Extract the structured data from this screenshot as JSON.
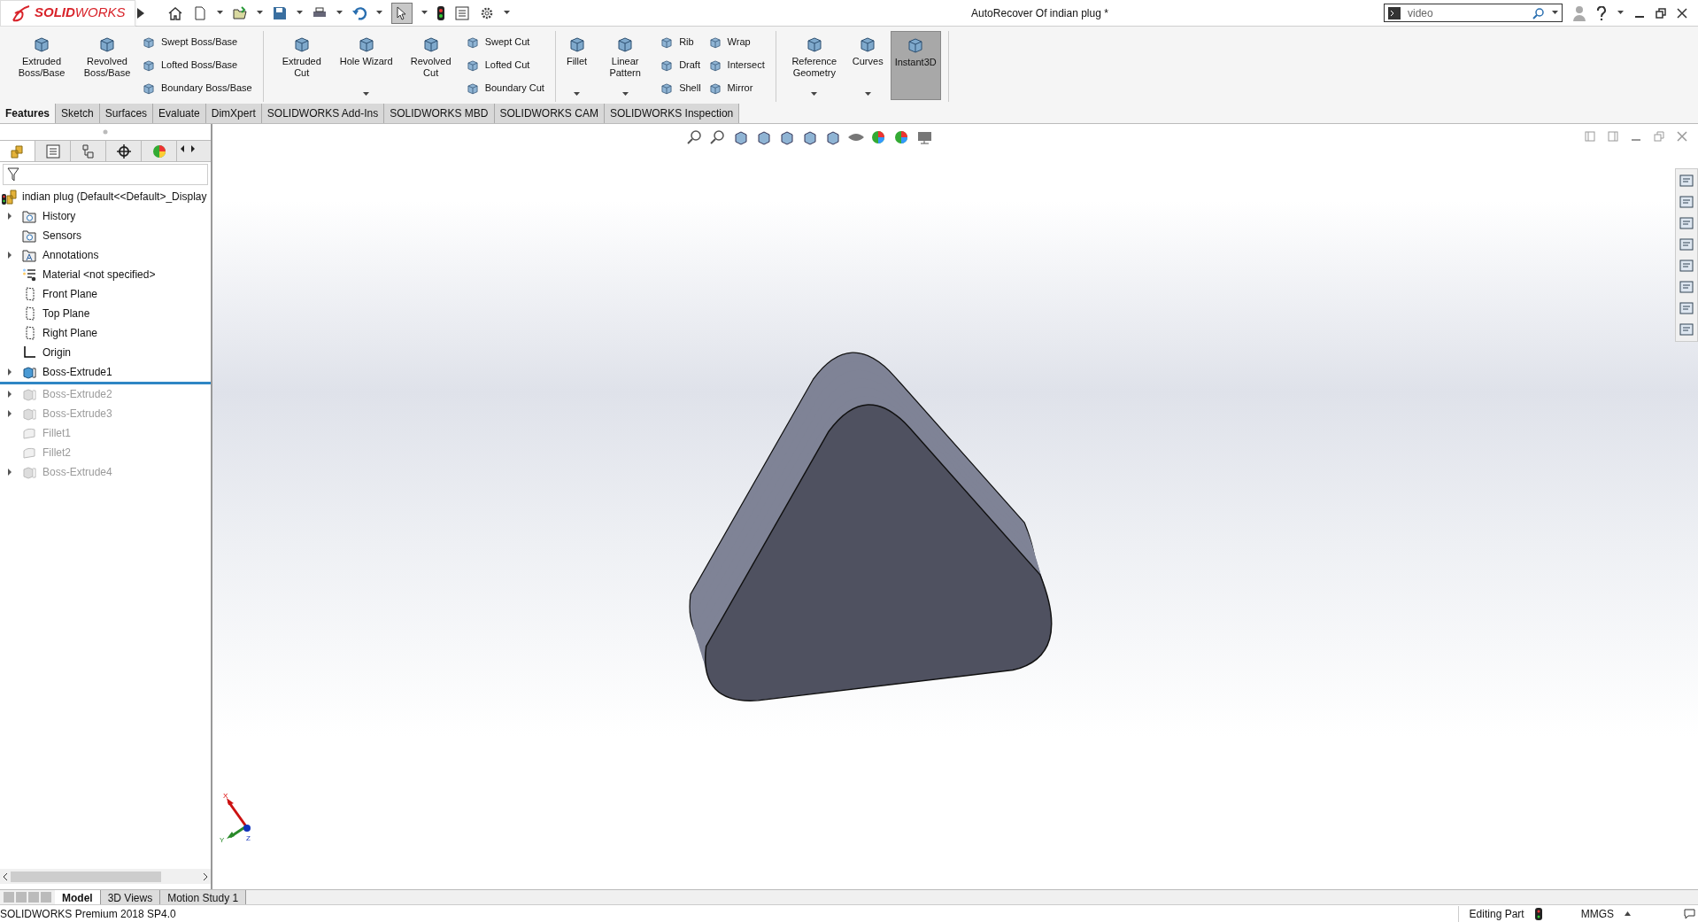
{
  "title_bar": {
    "logo": {
      "prefix": "SOLID",
      "suffix": "WORKS"
    },
    "select_tool": {
      "selected": true
    },
    "document_title": "AutoRecover Of indian plug *",
    "search": {
      "value": "video"
    }
  },
  "command_groups": [
    [
      {
        "kind": "large",
        "label": "Extruded Boss/Base",
        "dropdown": false,
        "selected": false
      },
      {
        "kind": "large",
        "label": "Revolved Boss/Base",
        "dropdown": false,
        "selected": false
      },
      {
        "kind": "stack",
        "items": [
          {
            "label": "Swept Boss/Base"
          },
          {
            "label": "Lofted Boss/Base"
          },
          {
            "label": "Boundary Boss/Base"
          }
        ]
      }
    ],
    [
      {
        "kind": "large",
        "label": "Extruded Cut",
        "dropdown": false,
        "selected": false
      },
      {
        "kind": "large",
        "label": "Hole Wizard",
        "dropdown": true,
        "selected": false
      },
      {
        "kind": "large",
        "label": "Revolved Cut",
        "dropdown": false,
        "selected": false
      },
      {
        "kind": "stack",
        "items": [
          {
            "label": "Swept Cut"
          },
          {
            "label": "Lofted Cut"
          },
          {
            "label": "Boundary Cut"
          }
        ]
      }
    ],
    [
      {
        "kind": "large",
        "label": "Fillet",
        "dropdown": true,
        "selected": false
      },
      {
        "kind": "large",
        "label": "Linear Pattern",
        "dropdown": true,
        "selected": false
      },
      {
        "kind": "stack",
        "items": [
          {
            "label": "Rib"
          },
          {
            "label": "Draft"
          },
          {
            "label": "Shell"
          }
        ]
      },
      {
        "kind": "stack",
        "items": [
          {
            "label": "Wrap"
          },
          {
            "label": "Intersect"
          },
          {
            "label": "Mirror"
          }
        ]
      }
    ],
    [
      {
        "kind": "large",
        "label": "Reference Geometry",
        "dropdown": true,
        "selected": false
      },
      {
        "kind": "large",
        "label": "Curves",
        "dropdown": true,
        "selected": false
      },
      {
        "kind": "large",
        "label": "Instant3D",
        "dropdown": false,
        "selected": true
      }
    ]
  ],
  "tabs": [
    {
      "label": "Features",
      "selected": true
    },
    {
      "label": "Sketch",
      "selected": false
    },
    {
      "label": "Surfaces",
      "selected": false
    },
    {
      "label": "Evaluate",
      "selected": false
    },
    {
      "label": "DimXpert",
      "selected": false
    },
    {
      "label": "SOLIDWORKS Add-Ins",
      "selected": false
    },
    {
      "label": "SOLIDWORKS MBD",
      "selected": false
    },
    {
      "label": "SOLIDWORKS CAM",
      "selected": false
    },
    {
      "label": "SOLIDWORKS Inspection",
      "selected": false
    }
  ],
  "feature_tree": {
    "root": "indian plug  (Default<<Default>_Display",
    "items": [
      {
        "label": "History",
        "kind": "folder",
        "expander": true,
        "suppressed": false,
        "rollback_bar": false
      },
      {
        "label": "Sensors",
        "kind": "folder",
        "expander": false,
        "suppressed": false,
        "rollback_bar": false
      },
      {
        "label": "Annotations",
        "kind": "annotations",
        "expander": true,
        "suppressed": false,
        "rollback_bar": false
      },
      {
        "label": "Material <not specified>",
        "kind": "material",
        "expander": false,
        "suppressed": false,
        "rollback_bar": false
      },
      {
        "label": "Front Plane",
        "kind": "plane",
        "expander": false,
        "suppressed": false,
        "rollback_bar": false
      },
      {
        "label": "Top Plane",
        "kind": "plane",
        "expander": false,
        "suppressed": false,
        "rollback_bar": false
      },
      {
        "label": "Right Plane",
        "kind": "plane",
        "expander": false,
        "suppressed": false,
        "rollback_bar": false
      },
      {
        "label": "Origin",
        "kind": "origin",
        "expander": false,
        "suppressed": false,
        "rollback_bar": false
      },
      {
        "label": "Boss-Extrude1",
        "kind": "extrude",
        "expander": true,
        "suppressed": false,
        "rollback_bar": true
      },
      {
        "label": "Boss-Extrude2",
        "kind": "extrude",
        "expander": true,
        "suppressed": true,
        "rollback_bar": false
      },
      {
        "label": "Boss-Extrude3",
        "kind": "extrude",
        "expander": true,
        "suppressed": true,
        "rollback_bar": false
      },
      {
        "label": "Fillet1",
        "kind": "fillet",
        "expander": false,
        "suppressed": true,
        "rollback_bar": false
      },
      {
        "label": "Fillet2",
        "kind": "fillet",
        "expander": false,
        "suppressed": true,
        "rollback_bar": false
      },
      {
        "label": "Boss-Extrude4",
        "kind": "extrude",
        "expander": true,
        "suppressed": true,
        "rollback_bar": false
      }
    ]
  },
  "triad": {
    "x": "X",
    "y": "Y",
    "z": "Z"
  },
  "bottom_tabs": [
    {
      "label": "Model",
      "selected": true
    },
    {
      "label": "3D Views",
      "selected": false
    },
    {
      "label": "Motion Study 1",
      "selected": false
    }
  ],
  "status_bar": {
    "product": "SOLIDWORKS Premium 2018 SP4.0",
    "mode": "Editing Part",
    "units": "MMGS"
  }
}
